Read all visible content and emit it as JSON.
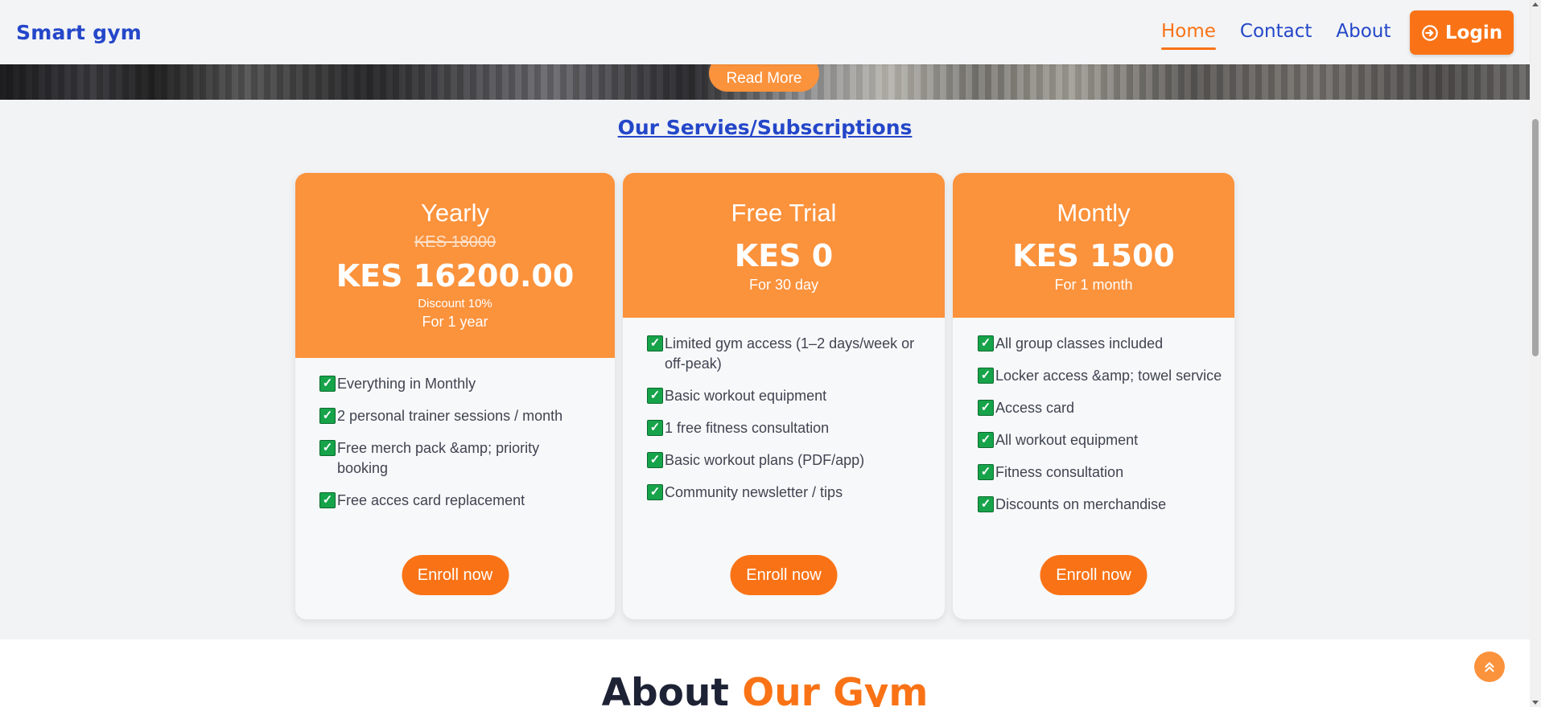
{
  "header": {
    "brand": "Smart gym",
    "nav": [
      {
        "label": "Home",
        "active": true
      },
      {
        "label": "Contact",
        "active": false
      },
      {
        "label": "About",
        "active": false
      }
    ],
    "login_label": "Login",
    "login_icon": "sign-in-icon"
  },
  "hero": {
    "read_more_label": "Read More"
  },
  "services": {
    "title": "Our Servies/Subscriptions",
    "plans": [
      {
        "name": "Yearly",
        "old_price": "KES 18000",
        "price": "KES 16200.00",
        "discount": "Discount 10%",
        "period": "For 1 year",
        "features": [
          "Everything in Monthly",
          "2 personal trainer sessions / month",
          "Free merch pack &amp; priority booking",
          "Free acces card replacement"
        ],
        "button": "Enroll now"
      },
      {
        "name": "Free Trial",
        "price": "KES 0",
        "period": "For 30 day",
        "features": [
          "Limited gym access (1–2 days/week or off-peak)",
          "Basic workout equipment",
          "1 free fitness consultation",
          "Basic workout plans (PDF/app)",
          "Community newsletter / tips"
        ],
        "button": "Enroll now"
      },
      {
        "name": "Montly",
        "price": "KES 1500",
        "period": "For 1 month",
        "features": [
          "All group classes included",
          "Locker access &amp; towel service",
          "Access card",
          "All workout equipment",
          "Fitness consultation",
          "Discounts on merchandise"
        ],
        "button": "Enroll now"
      }
    ],
    "check_symbol": "✓"
  },
  "about": {
    "title_part1": "About",
    "title_part2": "Our Gym"
  },
  "colors": {
    "accent": "#f97316",
    "card_header": "#fb923c",
    "brand_blue": "#2447c9",
    "check_green": "#16a34a"
  }
}
